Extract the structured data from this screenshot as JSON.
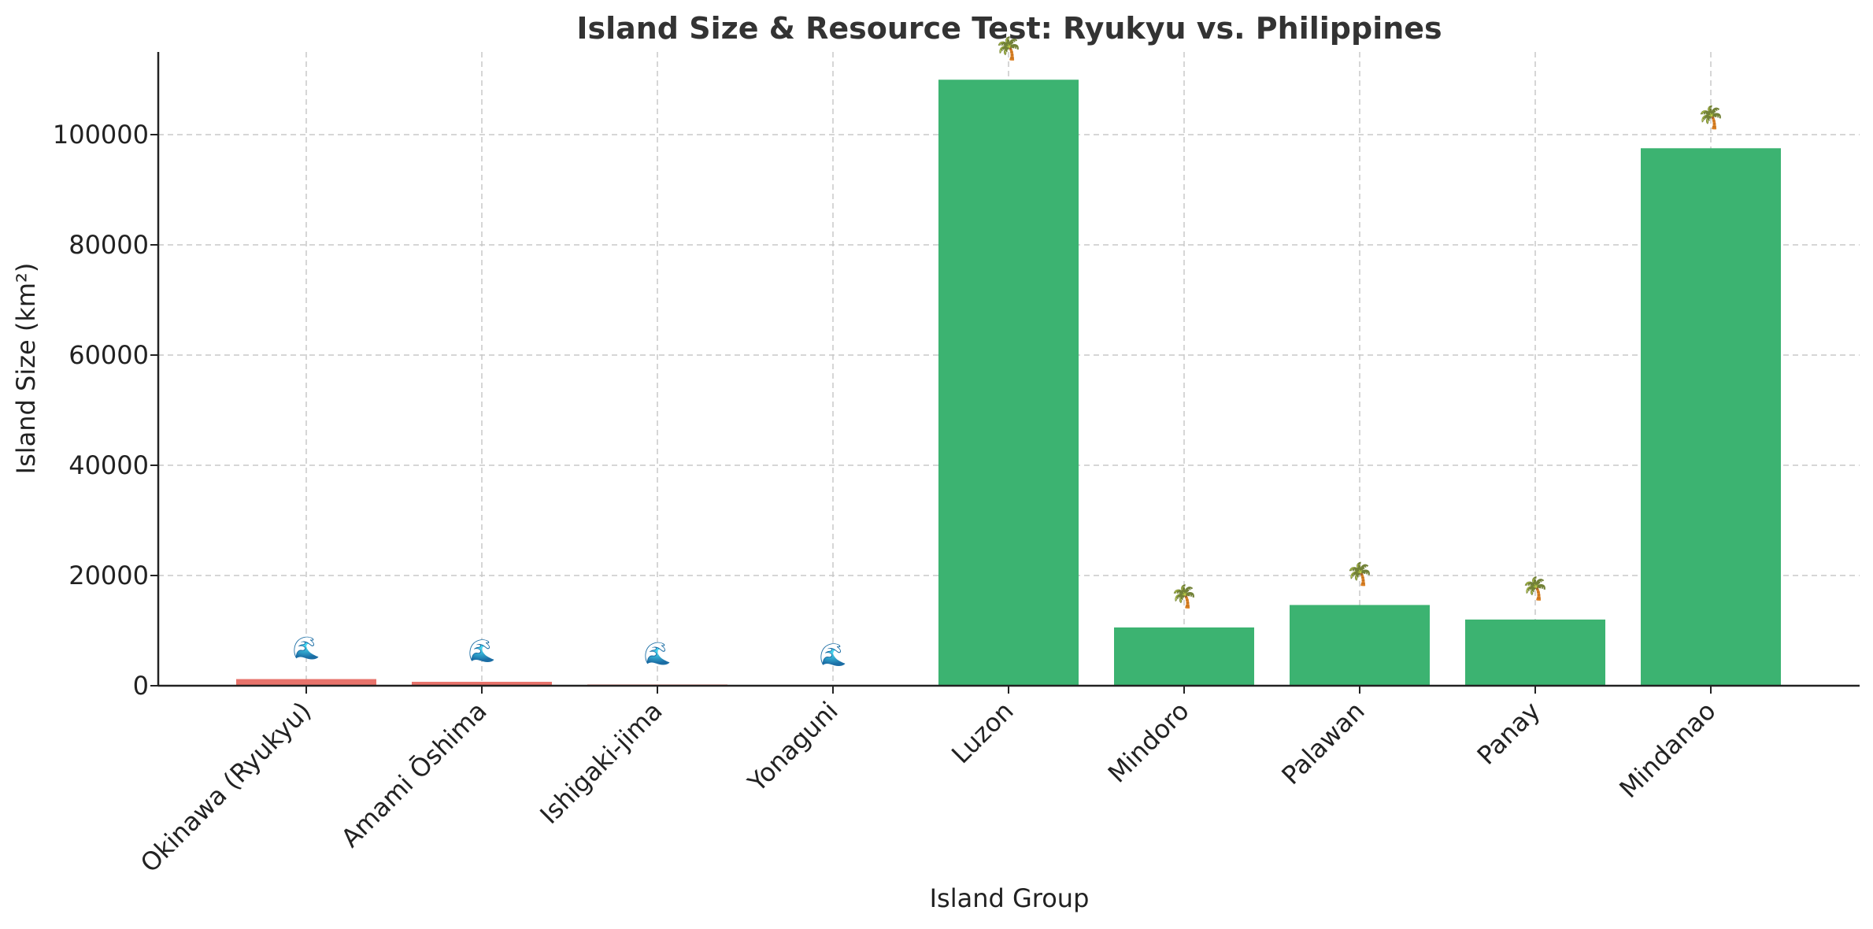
{
  "chart_data": {
    "type": "bar",
    "title": "Island Size & Resource Test: Ryukyu vs. Philippines",
    "xlabel": "Island Group",
    "ylabel": "Island Size (km²)",
    "ylim": [
      0,
      115000
    ],
    "yticks": [
      0,
      20000,
      40000,
      60000,
      80000,
      100000
    ],
    "grid": true,
    "categories": [
      "Okinawa (Ryukyu)",
      "Amami Ōshima",
      "Ishigaki-jima",
      "Yonaguni",
      "Luzon",
      "Mindoro",
      "Palawan",
      "Panay",
      "Mindanao"
    ],
    "values": [
      1207,
      712,
      222,
      29,
      109965,
      10572,
      14650,
      12011,
      97530
    ],
    "bar_colors": [
      "#e8736b",
      "#e8736b",
      "#e8736b",
      "#e8736b",
      "#3cb371",
      "#3cb371",
      "#3cb371",
      "#3cb371",
      "#3cb371"
    ],
    "annotations": [
      "🌊",
      "🌊",
      "🌊",
      "🌊",
      "🌴",
      "🌴",
      "🌴",
      "🌴",
      "🌴"
    ]
  }
}
